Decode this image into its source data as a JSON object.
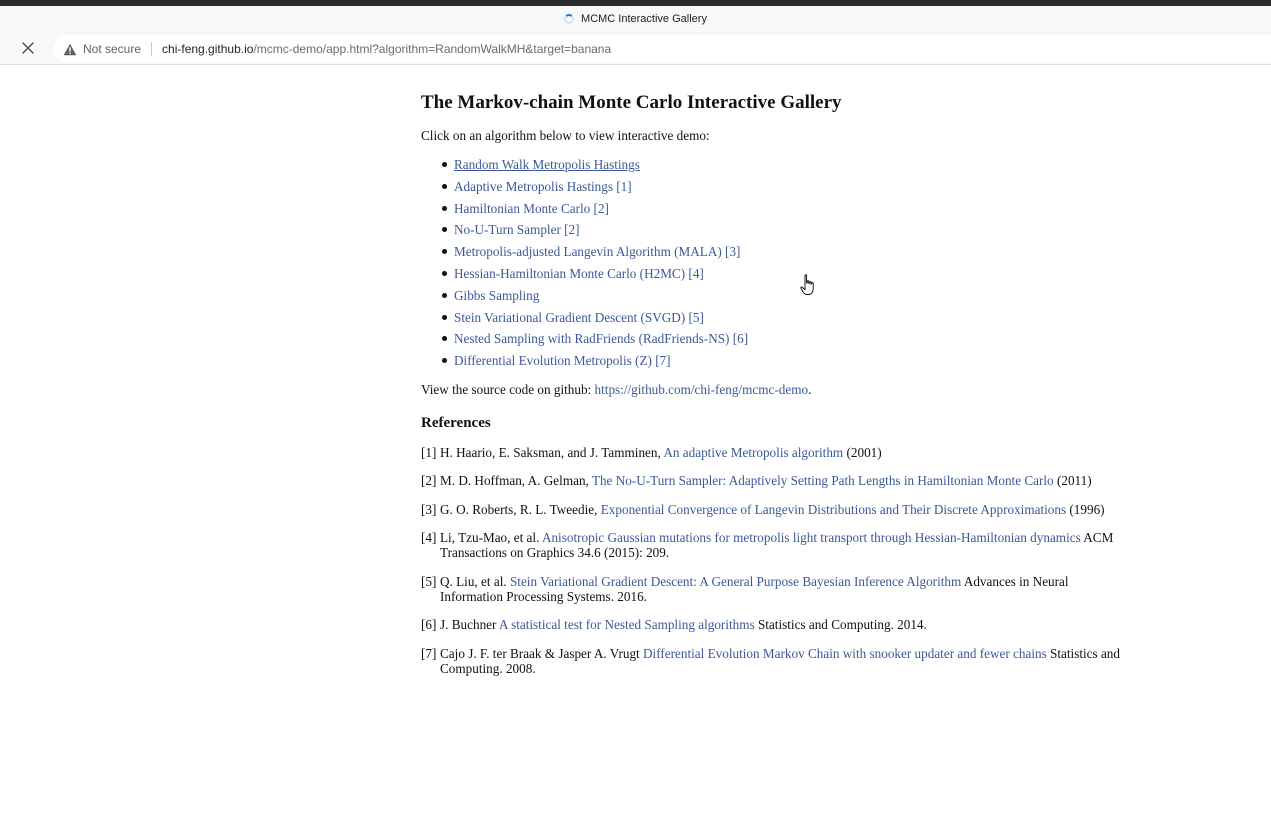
{
  "browser": {
    "tab_title": "MCMC Interactive Gallery",
    "security_label": "Not secure",
    "url_domain": "chi-feng.github.io",
    "url_path": "/mcmc-demo/app.html?algorithm=RandomWalkMH&target=banana",
    "icons": {
      "close": "close-icon",
      "warning": "warning-icon",
      "loading": "loading-spinner-icon"
    }
  },
  "page": {
    "title": "The Markov-chain Monte Carlo Interactive Gallery",
    "intro": "Click on an algorithm below to view interactive demo:",
    "algorithms": [
      {
        "label": "Random Walk Metropolis Hastings",
        "ref": ""
      },
      {
        "label": "Adaptive Metropolis Hastings",
        "ref": "[1]"
      },
      {
        "label": "Hamiltonian Monte Carlo",
        "ref": "[2]"
      },
      {
        "label": "No-U-Turn Sampler",
        "ref": "[2]"
      },
      {
        "label": "Metropolis-adjusted Langevin Algorithm (MALA)",
        "ref": "[3]"
      },
      {
        "label": "Hessian-Hamiltonian Monte Carlo (H2MC)",
        "ref": "[4]"
      },
      {
        "label": "Gibbs Sampling",
        "ref": ""
      },
      {
        "label": "Stein Variational Gradient Descent (SVGD)",
        "ref": "[5]"
      },
      {
        "label": "Nested Sampling with RadFriends (RadFriends-NS)",
        "ref": "[6]"
      },
      {
        "label": "Differential Evolution Metropolis (Z)",
        "ref": "[7]"
      }
    ],
    "source_prefix": "View the source code on github: ",
    "source_link": "https://github.com/chi-feng/mcmc-demo",
    "source_suffix": ".",
    "references_heading": "References",
    "references": [
      {
        "num": "[1]",
        "authors": "H. Haario, E. Saksman, and J. Tamminen, ",
        "link": "An adaptive Metropolis algorithm",
        "suffix": " (2001)"
      },
      {
        "num": "[2]",
        "authors": "M. D. Hoffman, A. Gelman, ",
        "link": "The No-U-Turn Sampler: Adaptively Setting Path Lengths in Hamiltonian Monte Carlo",
        "suffix": " (2011)"
      },
      {
        "num": "[3]",
        "authors": "G. O. Roberts, R. L. Tweedie, ",
        "link": "Exponential Convergence of Langevin Distributions and Their Discrete Approximations",
        "suffix": " (1996)"
      },
      {
        "num": "[4]",
        "authors": "Li, Tzu-Mao, et al. ",
        "link": "Anisotropic Gaussian mutations for metropolis light transport through Hessian-Hamiltonian dynamics",
        "suffix": " ACM Transactions on Graphics 34.6 (2015): 209."
      },
      {
        "num": "[5]",
        "authors": "Q. Liu, et al. ",
        "link": "Stein Variational Gradient Descent: A General Purpose Bayesian Inference Algorithm",
        "suffix": " Advances in Neural Information Processing Systems. 2016."
      },
      {
        "num": "[6]",
        "authors": "J. Buchner ",
        "link": "A statistical test for Nested Sampling algorithms",
        "suffix": " Statistics and Computing. 2014."
      },
      {
        "num": "[7]",
        "authors": "Cajo J. F. ter Braak & Jasper A. Vrugt ",
        "link": "Differential Evolution Markov Chain with snooker updater and fewer chains",
        "suffix": " Statistics and Computing. 2008."
      }
    ]
  },
  "colors": {
    "link": "#3b5998",
    "text": "#111111",
    "chrome_bg": "#f8f8f8",
    "spinner_accent": "#1a73e8"
  }
}
